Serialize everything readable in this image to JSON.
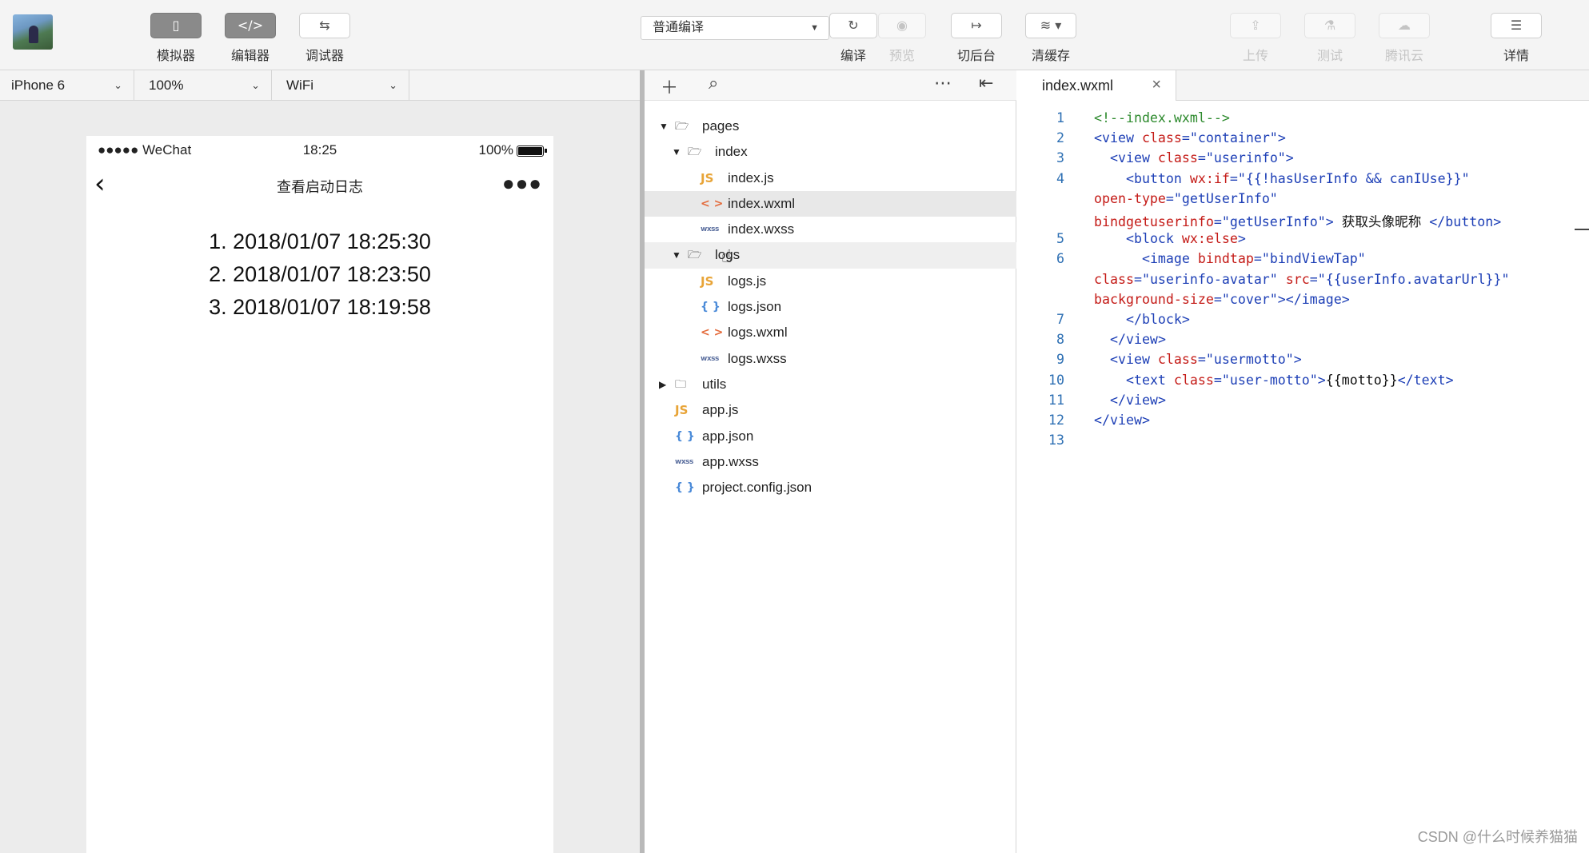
{
  "toolbar": {
    "simulator_label": "模拟器",
    "editor_label": "编辑器",
    "debugger_label": "调试器",
    "compile_mode": "普通编译",
    "compile_label": "编译",
    "preview_label": "预览",
    "background_label": "切后台",
    "clear_cache_label": "清缓存",
    "upload_label": "上传",
    "test_label": "测试",
    "tencent_cloud_label": "腾讯云",
    "details_label": "详情"
  },
  "sim_bar": {
    "device": "iPhone 6",
    "zoom": "100%",
    "network": "WiFi"
  },
  "phone": {
    "carrier": "●●●●● WeChat",
    "time": "18:25",
    "battery_text": "100%",
    "nav_title": "查看启动日志",
    "logs": [
      "1. 2018/01/07 18:25:30",
      "2. 2018/01/07 18:23:50",
      "3. 2018/01/07 18:19:58"
    ]
  },
  "tree": {
    "items": [
      {
        "label": "pages",
        "icon": "folder-open-icon"
      },
      {
        "label": "index",
        "icon": "folder-open-icon"
      },
      {
        "label": "index.js",
        "icon": "js-file-icon",
        "icon_text": "JS"
      },
      {
        "label": "index.wxml",
        "icon": "wxml-file-icon",
        "icon_text": "< >"
      },
      {
        "label": "index.wxss",
        "icon": "wxss-file-icon",
        "icon_text": "wxss"
      },
      {
        "label": "logs",
        "icon": "folder-open-icon"
      },
      {
        "label": "logs.js",
        "icon": "js-file-icon",
        "icon_text": "JS"
      },
      {
        "label": "logs.json",
        "icon": "json-file-icon",
        "icon_text": "{ }"
      },
      {
        "label": "logs.wxml",
        "icon": "wxml-file-icon",
        "icon_text": "< >"
      },
      {
        "label": "logs.wxss",
        "icon": "wxss-file-icon",
        "icon_text": "wxss"
      },
      {
        "label": "utils",
        "icon": "folder-icon"
      },
      {
        "label": "app.js",
        "icon": "js-file-icon",
        "icon_text": "JS"
      },
      {
        "label": "app.json",
        "icon": "json-file-icon",
        "icon_text": "{ }"
      },
      {
        "label": "app.wxss",
        "icon": "wxss-file-icon",
        "icon_text": "wxss"
      },
      {
        "label": "project.config.json",
        "icon": "json-file-icon",
        "icon_text": "{ }"
      }
    ]
  },
  "editor": {
    "tab_name": "index.wxml",
    "line_numbers": [
      "1",
      "2",
      "3",
      "4",
      "5",
      "6",
      "7",
      "8",
      "9",
      "10",
      "11",
      "12",
      "13"
    ],
    "lines": [
      "<!--index.wxml-->",
      "<view class=\"container\">",
      "  <view class=\"userinfo\">",
      "    <button wx:if=\"{{!hasUserInfo && canIUse}}\"",
      "open-type=\"getUserInfo\"",
      "bindgetuserinfo=\"getUserInfo\"> 获取头像昵称 </button>",
      "    <block wx:else>",
      "      <image bindtap=\"bindViewTap\"",
      "class=\"userinfo-avatar\" src=\"{{userInfo.avatarUrl}}\"",
      "background-size=\"cover\"></image>",
      "    </block>",
      "  </view>",
      "  <view class=\"usermotto\">",
      "    <text class=\"user-motto\">{{motto}}</text>",
      "  </view>",
      "</view>",
      ""
    ]
  },
  "watermark": "CSDN @什么时候养猫猫"
}
